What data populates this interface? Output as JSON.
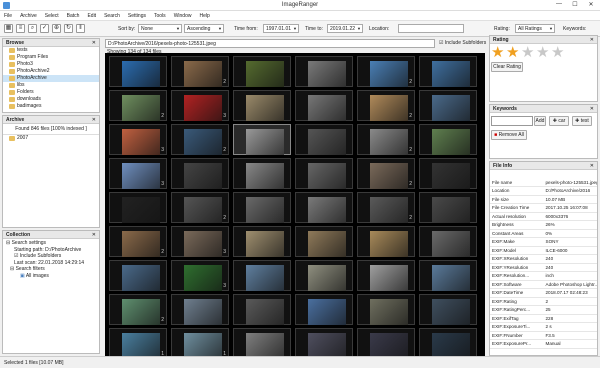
{
  "window": {
    "title": "ImageRanger",
    "controls": [
      "—",
      "☐",
      "✕"
    ]
  },
  "menu": [
    "File",
    "Archive",
    "Select",
    "Batch",
    "Edit",
    "Search",
    "Settings",
    "Tools",
    "Window",
    "Help"
  ],
  "toolbar": {
    "sort_label": "Sort by:",
    "sort_value": "None",
    "order_value": "Ascending",
    "time_from_label": "Time from:",
    "time_from_value": "1997.01.01",
    "time_to_label": "Time to:",
    "time_to_value": "2019.01.22",
    "location_label": "Location:",
    "location_value": "",
    "rating_label": "Rating:",
    "rating_value": "All Ratings",
    "keywords_label": "Keywords:"
  },
  "browse": {
    "title": "Browse",
    "items": [
      {
        "label": "tests",
        "selected": false
      },
      {
        "label": "Program Files",
        "selected": false
      },
      {
        "label": "Photo3",
        "selected": false
      },
      {
        "label": "PhotoArchive2",
        "selected": false
      },
      {
        "label": "PhotoArchive",
        "selected": true
      },
      {
        "label": "libs",
        "selected": false
      },
      {
        "label": "Folders",
        "selected": false
      },
      {
        "label": "downloads",
        "selected": false
      },
      {
        "label": "badimages",
        "selected": false
      }
    ]
  },
  "archive": {
    "title": "Archive",
    "found": "Found 846 files [100% indexed ]",
    "items": [
      "2007"
    ]
  },
  "collection": {
    "title": "Collection",
    "items": [
      "Search settings",
      "Starting path: D:/PhotoArchive",
      "Include Subfolders",
      "Last scan: 22.01.2018 14:29:14",
      "Search filters",
      "All images"
    ]
  },
  "path": {
    "value": "D:/PhotoArchive/2016/pexels-photo-125531.jpeg",
    "include_subfolders": "Include Subfolders",
    "showing": "Showing 134 of 134 files"
  },
  "grid": {
    "rows": [
      [
        {
          "c": "#2b6cb0",
          "n": ""
        },
        {
          "c": "#8a6a4a",
          "n": "2"
        },
        {
          "c": "#556b2f",
          "n": ""
        },
        {
          "c": "#7a7a7a",
          "n": ""
        },
        {
          "c": "#4a7fb5",
          "n": "2"
        },
        {
          "c": "#3f6f9f",
          "n": ""
        }
      ],
      [
        {
          "c": "#6f8f5f",
          "n": "2"
        },
        {
          "c": "#b22222",
          "n": "3"
        },
        {
          "c": "#9a8a6a",
          "n": ""
        },
        {
          "c": "#777777",
          "n": ""
        },
        {
          "c": "#b08a5a",
          "n": "2"
        },
        {
          "c": "#4a6a8a",
          "n": ""
        }
      ],
      [
        {
          "c": "#c06040",
          "n": "3"
        },
        {
          "c": "#3a5a7a",
          "n": "2"
        },
        {
          "c": "#999999",
          "n": ""
        },
        {
          "c": "#555555",
          "n": ""
        },
        {
          "c": "#8a8a8a",
          "n": "2"
        },
        {
          "c": "#5f7f4f",
          "n": ""
        }
      ],
      [
        {
          "c": "#6f8fbf",
          "n": "3"
        },
        {
          "c": "#444444",
          "n": ""
        },
        {
          "c": "#888888",
          "n": ""
        },
        {
          "c": "#666666",
          "n": ""
        },
        {
          "c": "#7a6a5a",
          "n": "2"
        },
        {
          "c": "#333333",
          "n": ""
        }
      ],
      [
        {
          "c": "#222222",
          "n": ""
        },
        {
          "c": "#555555",
          "n": "2"
        },
        {
          "c": "#6a6a6a",
          "n": ""
        },
        {
          "c": "#7a7a7a",
          "n": ""
        },
        {
          "c": "#5a5a5a",
          "n": "2"
        },
        {
          "c": "#4a4a4a",
          "n": ""
        }
      ],
      [
        {
          "c": "#8a6a4a",
          "n": "2"
        },
        {
          "c": "#7a6a5a",
          "n": "3"
        },
        {
          "c": "#9f8f6f",
          "n": ""
        },
        {
          "c": "#8f7a5a",
          "n": ""
        },
        {
          "c": "#a88a5a",
          "n": ""
        },
        {
          "c": "#6a6a6a",
          "n": ""
        }
      ],
      [
        {
          "c": "#4a6a8a",
          "n": ""
        },
        {
          "c": "#2f6f2f",
          "n": "3"
        },
        {
          "c": "#5f7f9f",
          "n": ""
        },
        {
          "c": "#8f8f7f",
          "n": ""
        },
        {
          "c": "#9f9f9f",
          "n": ""
        },
        {
          "c": "#5a7a9a",
          "n": ""
        }
      ],
      [
        {
          "c": "#5f8f6f",
          "n": "2"
        },
        {
          "c": "#6f7f8f",
          "n": ""
        },
        {
          "c": "#5a5a5a",
          "n": ""
        },
        {
          "c": "#4a6f9f",
          "n": ""
        },
        {
          "c": "#6f6f5f",
          "n": ""
        },
        {
          "c": "#3f4f5f",
          "n": ""
        }
      ],
      [
        {
          "c": "#4a7f9f",
          "n": "1"
        },
        {
          "c": "#6f8f9f",
          "n": "1"
        },
        {
          "c": "#7f7f7f",
          "n": ""
        },
        {
          "c": "#4f4f5f",
          "n": ""
        },
        {
          "c": "#3a3a4a",
          "n": ""
        },
        {
          "c": "#2a3a4a",
          "n": ""
        }
      ]
    ]
  },
  "rating": {
    "title": "Rating",
    "stars": 2,
    "max": 5,
    "clear": "Clear Rating"
  },
  "keywords": {
    "title": "Keywords",
    "add": "Add",
    "tags": [
      "car",
      "test"
    ],
    "remove_all": "Remove All"
  },
  "fileinfo": {
    "title": "File Info",
    "rows": [
      [
        "File name",
        "pexels-photo-125531.jpeg"
      ],
      [
        "Location",
        "D:/PhotoArchive/2016"
      ],
      [
        "File size",
        "10.07 MB"
      ],
      [
        "File Creation Time",
        "2017.10.25 16:07:08"
      ],
      [
        "Actual resolution",
        "6000x3376"
      ],
      [
        "Brightness",
        "26%"
      ],
      [
        "Constant Areas",
        "0%"
      ],
      [
        "EXIF:Make",
        "SONY"
      ],
      [
        "EXIF:Model",
        "ILCE-6000"
      ],
      [
        "EXIF:XResolution",
        "240"
      ],
      [
        "EXIF:YResolution",
        "240"
      ],
      [
        "EXIF:Resolution...",
        "inch"
      ],
      [
        "EXIF:Software",
        "Adobe Photoshop Lightr..."
      ],
      [
        "EXIF:DateTime",
        "2018.07.17 02:48:23"
      ],
      [
        "EXIF:Rating",
        "2"
      ],
      [
        "EXIF:RatingPerc...",
        "25"
      ],
      [
        "EXIF:ExifTag",
        "228"
      ],
      [
        "EXIF:ExposureTi...",
        "2 s"
      ],
      [
        "EXIF:FNumber",
        "F3.5"
      ],
      [
        "EXIF:ExposurePr...",
        "Manual"
      ]
    ]
  },
  "status": {
    "text": "Selected 1 files [10.07 MB]"
  },
  "colors": {
    "accent": "#cce4f7",
    "star_on": "#f0a020",
    "star_off": "#c8c8c8",
    "grid_bg": "#000000"
  }
}
